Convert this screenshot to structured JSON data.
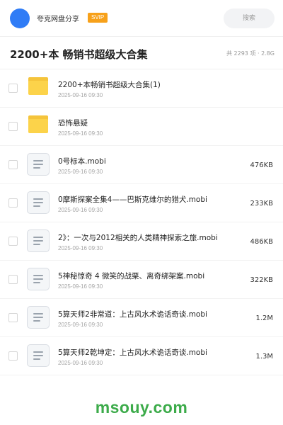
{
  "header": {
    "user_name": "夸克网盘分享",
    "vip_badge": "SVIP",
    "search_placeholder": "搜索",
    "avatar_color": "#2f7cf6"
  },
  "title_bar": {
    "title": "2200+本 畅销书超级大合集",
    "summary": "共 2293 项 · 2.8G"
  },
  "files": [
    {
      "type": "folder",
      "icon": "folder-icon",
      "name": "2200+本畅销书超级大合集(1)",
      "date": "2025-09-16 09:30",
      "size": ""
    },
    {
      "type": "folder",
      "icon": "folder-icon",
      "name": "恐怖悬疑",
      "date": "2025-09-16 09:30",
      "size": ""
    },
    {
      "type": "file",
      "icon": "document-icon",
      "name": "0号标本.mobi",
      "date": "2025-09-16 09:30",
      "size": "476KB"
    },
    {
      "type": "file",
      "icon": "document-icon",
      "name": "0摩斯探案全集4——巴斯克维尔的猎犬.mobi",
      "date": "2025-09-16 09:30",
      "size": "233KB"
    },
    {
      "type": "file",
      "icon": "document-icon",
      "name": "2》：一次与2012相关的人类精神探索之旅.mobi",
      "date": "2025-09-16 09:30",
      "size": "486KB"
    },
    {
      "type": "file",
      "icon": "document-icon",
      "name": "5神秘惊奇 4 微笑的战栗、离奇绑架案.mobi",
      "date": "2025-09-16 09:30",
      "size": "322KB"
    },
    {
      "type": "file",
      "icon": "document-icon",
      "name": "5算天师2非常道：上古风水术诡话奇谈.mobi",
      "date": "2025-09-16 09:30",
      "size": "1.2M"
    },
    {
      "type": "file",
      "icon": "document-icon",
      "name": "5算天师2乾坤定：上古风水术诡话奇谈.mobi",
      "date": "2025-09-16 09:30",
      "size": "1.3M"
    }
  ],
  "watermark": "msouy.com",
  "colors": {
    "vip": "#f7a11a",
    "folder": "#fcd34a",
    "watermark": "#3cab4a"
  }
}
